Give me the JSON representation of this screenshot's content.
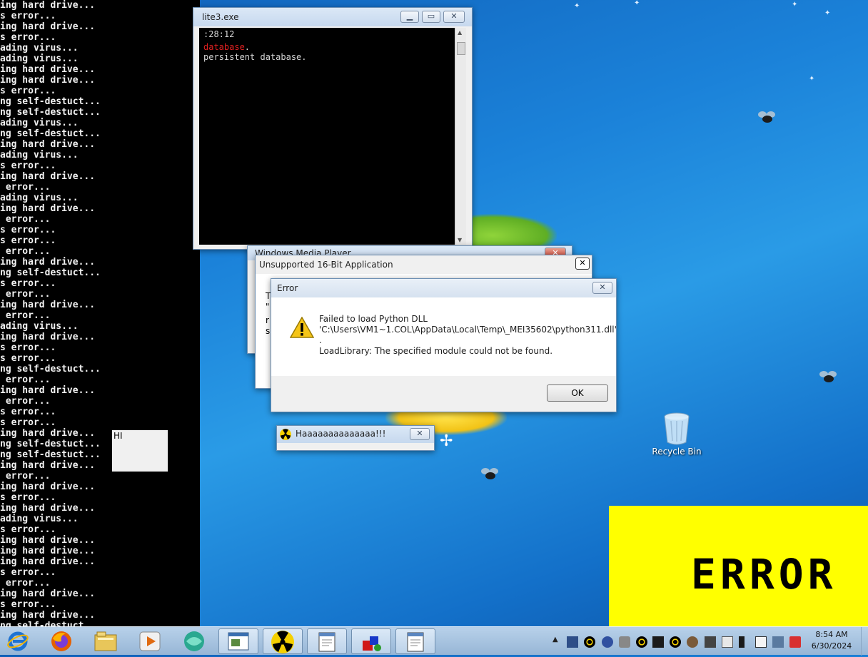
{
  "left_console": {
    "lines": [
      "ing hard drive...",
      "s error...",
      "ing hard drive...",
      "s error...",
      "ading virus...",
      "ading virus...",
      "ing hard drive...",
      "ing hard drive...",
      "s error...",
      "ng self-destuct...",
      "ng self-destuct...",
      "ading virus...",
      "ng self-destuct...",
      "ing hard drive...",
      "ading virus...",
      "s error...",
      "ing hard drive...",
      " error...",
      "ading virus...",
      "ing hard drive...",
      " error...",
      "s error...",
      "s error...",
      " error...",
      "ing hard drive...",
      "ng self-destuct...",
      "s error...",
      " error...",
      "ing hard drive...",
      " error...",
      "ading virus...",
      "ing hard drive...",
      "s error...",
      "s error...",
      "ng self-destuct...",
      " error...",
      "ing hard drive...",
      " error...",
      "s error...",
      "s error...",
      "ing hard drive...",
      "ng self-destuct...",
      "ng self-destuct...",
      "ing hard drive...",
      " error...",
      "ing hard drive...",
      "s error...",
      "ing hard drive...",
      "ading virus...",
      "s error...",
      "ing hard drive...",
      "ing hard drive...",
      "ing hard drive...",
      "s error...",
      " error...",
      "ing hard drive...",
      "s error...",
      "ing hard drive...",
      "ng self-destuct"
    ]
  },
  "sqlite_window": {
    "title": "lite3.exe",
    "line1": ":28:12",
    "line2_red": "database",
    "line2_rest": ".",
    "line3": " persistent database."
  },
  "media_player_window": {
    "title": "Windows Media Player"
  },
  "unsupported_window": {
    "title": "Unsupported 16-Bit Application",
    "frag1": "T",
    "frag2": "\"",
    "frag3": "r",
    "frag4": "s"
  },
  "error_dialog": {
    "title": "Error",
    "line1": "Failed to load Python DLL",
    "line2": "'C:\\Users\\VM1~1.COL\\AppData\\Local\\Temp\\_MEI35602\\python311.dll'",
    "line3": ".",
    "line4": "LoadLibrary: The specified module could not be found.",
    "ok_label": "OK"
  },
  "haaa_window": {
    "title": "Haaaaaaaaaaaaaa!!!"
  },
  "hi_box": {
    "text": "HI"
  },
  "recycle_bin": {
    "label": "Recycle Bin"
  },
  "error_banner": {
    "text": "ERROR"
  },
  "clock": {
    "time": "8:54 AM",
    "date": "6/30/2024"
  },
  "colors": {
    "banner": "#ffff00",
    "console_red": "#e02020",
    "taskbar": "#b8d1ea"
  },
  "taskbar_icons": [
    "internet-explorer-icon",
    "firefox-icon",
    "file-explorer-icon",
    "media-player-icon",
    "app-globe-icon",
    "window-app-icon",
    "radiation-icon",
    "notepad-icon",
    "shapes-app-icon",
    "notepad-icon"
  ]
}
